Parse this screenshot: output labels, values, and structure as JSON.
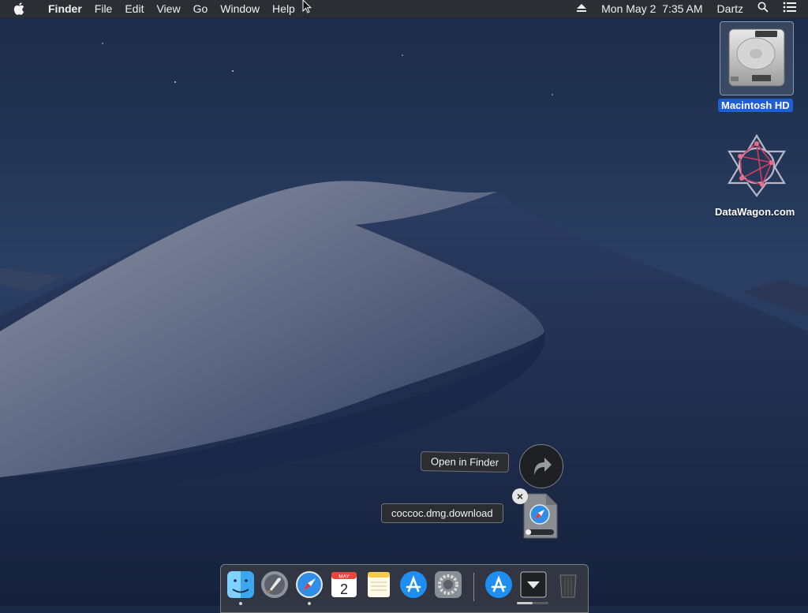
{
  "menubar": {
    "app_name": "Finder",
    "menus": [
      "File",
      "Edit",
      "View",
      "Go",
      "Window",
      "Help"
    ],
    "status": {
      "datetime": "Mon May 2  7:35 AM",
      "user": "Dartz",
      "icons": [
        "eject-icon",
        "spotlight-search-icon",
        "notification-center-icon"
      ]
    }
  },
  "desktop": {
    "icons": [
      {
        "label": "Macintosh HD",
        "icon": "hard-drive-icon",
        "selected": true
      },
      {
        "label": "DataWagon.com",
        "icon": "datawagon-logo-icon",
        "selected": false
      }
    ]
  },
  "downloads_popover": {
    "open_label": "Open in Finder",
    "file_name": "coccoc.dmg.download",
    "progress": 0.05
  },
  "dock": {
    "apps": [
      "Finder",
      "Launchpad",
      "Safari",
      "Calendar",
      "Notes",
      "App Store",
      "System Preferences"
    ],
    "calendar": {
      "month": "MAY",
      "day": "2"
    },
    "others": [
      "App Store",
      "Downloads",
      "Trash"
    ],
    "downloads_progress": 0.5
  },
  "colors": {
    "menubar_bg": "#2c2e33",
    "selection": "#1e5fd6",
    "safari_blue": "#2f8fe8"
  }
}
